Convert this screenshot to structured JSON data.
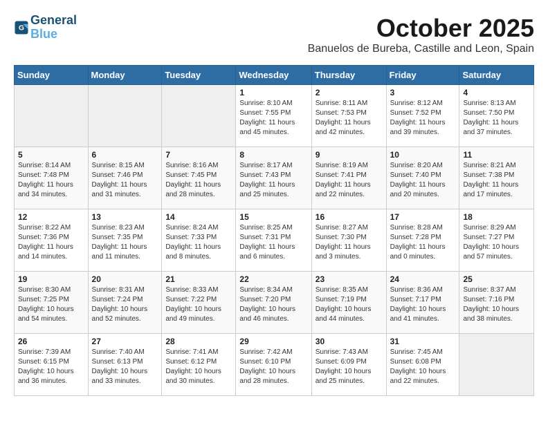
{
  "header": {
    "logo_line1": "General",
    "logo_line2": "Blue",
    "month": "October 2025",
    "location": "Banuelos de Bureba, Castille and Leon, Spain"
  },
  "weekdays": [
    "Sunday",
    "Monday",
    "Tuesday",
    "Wednesday",
    "Thursday",
    "Friday",
    "Saturday"
  ],
  "weeks": [
    [
      {
        "day": "",
        "info": ""
      },
      {
        "day": "",
        "info": ""
      },
      {
        "day": "",
        "info": ""
      },
      {
        "day": "1",
        "info": "Sunrise: 8:10 AM\nSunset: 7:55 PM\nDaylight: 11 hours and 45 minutes."
      },
      {
        "day": "2",
        "info": "Sunrise: 8:11 AM\nSunset: 7:53 PM\nDaylight: 11 hours and 42 minutes."
      },
      {
        "day": "3",
        "info": "Sunrise: 8:12 AM\nSunset: 7:52 PM\nDaylight: 11 hours and 39 minutes."
      },
      {
        "day": "4",
        "info": "Sunrise: 8:13 AM\nSunset: 7:50 PM\nDaylight: 11 hours and 37 minutes."
      }
    ],
    [
      {
        "day": "5",
        "info": "Sunrise: 8:14 AM\nSunset: 7:48 PM\nDaylight: 11 hours and 34 minutes."
      },
      {
        "day": "6",
        "info": "Sunrise: 8:15 AM\nSunset: 7:46 PM\nDaylight: 11 hours and 31 minutes."
      },
      {
        "day": "7",
        "info": "Sunrise: 8:16 AM\nSunset: 7:45 PM\nDaylight: 11 hours and 28 minutes."
      },
      {
        "day": "8",
        "info": "Sunrise: 8:17 AM\nSunset: 7:43 PM\nDaylight: 11 hours and 25 minutes."
      },
      {
        "day": "9",
        "info": "Sunrise: 8:19 AM\nSunset: 7:41 PM\nDaylight: 11 hours and 22 minutes."
      },
      {
        "day": "10",
        "info": "Sunrise: 8:20 AM\nSunset: 7:40 PM\nDaylight: 11 hours and 20 minutes."
      },
      {
        "day": "11",
        "info": "Sunrise: 8:21 AM\nSunset: 7:38 PM\nDaylight: 11 hours and 17 minutes."
      }
    ],
    [
      {
        "day": "12",
        "info": "Sunrise: 8:22 AM\nSunset: 7:36 PM\nDaylight: 11 hours and 14 minutes."
      },
      {
        "day": "13",
        "info": "Sunrise: 8:23 AM\nSunset: 7:35 PM\nDaylight: 11 hours and 11 minutes."
      },
      {
        "day": "14",
        "info": "Sunrise: 8:24 AM\nSunset: 7:33 PM\nDaylight: 11 hours and 8 minutes."
      },
      {
        "day": "15",
        "info": "Sunrise: 8:25 AM\nSunset: 7:31 PM\nDaylight: 11 hours and 6 minutes."
      },
      {
        "day": "16",
        "info": "Sunrise: 8:27 AM\nSunset: 7:30 PM\nDaylight: 11 hours and 3 minutes."
      },
      {
        "day": "17",
        "info": "Sunrise: 8:28 AM\nSunset: 7:28 PM\nDaylight: 11 hours and 0 minutes."
      },
      {
        "day": "18",
        "info": "Sunrise: 8:29 AM\nSunset: 7:27 PM\nDaylight: 10 hours and 57 minutes."
      }
    ],
    [
      {
        "day": "19",
        "info": "Sunrise: 8:30 AM\nSunset: 7:25 PM\nDaylight: 10 hours and 54 minutes."
      },
      {
        "day": "20",
        "info": "Sunrise: 8:31 AM\nSunset: 7:24 PM\nDaylight: 10 hours and 52 minutes."
      },
      {
        "day": "21",
        "info": "Sunrise: 8:33 AM\nSunset: 7:22 PM\nDaylight: 10 hours and 49 minutes."
      },
      {
        "day": "22",
        "info": "Sunrise: 8:34 AM\nSunset: 7:20 PM\nDaylight: 10 hours and 46 minutes."
      },
      {
        "day": "23",
        "info": "Sunrise: 8:35 AM\nSunset: 7:19 PM\nDaylight: 10 hours and 44 minutes."
      },
      {
        "day": "24",
        "info": "Sunrise: 8:36 AM\nSunset: 7:17 PM\nDaylight: 10 hours and 41 minutes."
      },
      {
        "day": "25",
        "info": "Sunrise: 8:37 AM\nSunset: 7:16 PM\nDaylight: 10 hours and 38 minutes."
      }
    ],
    [
      {
        "day": "26",
        "info": "Sunrise: 7:39 AM\nSunset: 6:15 PM\nDaylight: 10 hours and 36 minutes."
      },
      {
        "day": "27",
        "info": "Sunrise: 7:40 AM\nSunset: 6:13 PM\nDaylight: 10 hours and 33 minutes."
      },
      {
        "day": "28",
        "info": "Sunrise: 7:41 AM\nSunset: 6:12 PM\nDaylight: 10 hours and 30 minutes."
      },
      {
        "day": "29",
        "info": "Sunrise: 7:42 AM\nSunset: 6:10 PM\nDaylight: 10 hours and 28 minutes."
      },
      {
        "day": "30",
        "info": "Sunrise: 7:43 AM\nSunset: 6:09 PM\nDaylight: 10 hours and 25 minutes."
      },
      {
        "day": "31",
        "info": "Sunrise: 7:45 AM\nSunset: 6:08 PM\nDaylight: 10 hours and 22 minutes."
      },
      {
        "day": "",
        "info": ""
      }
    ]
  ]
}
